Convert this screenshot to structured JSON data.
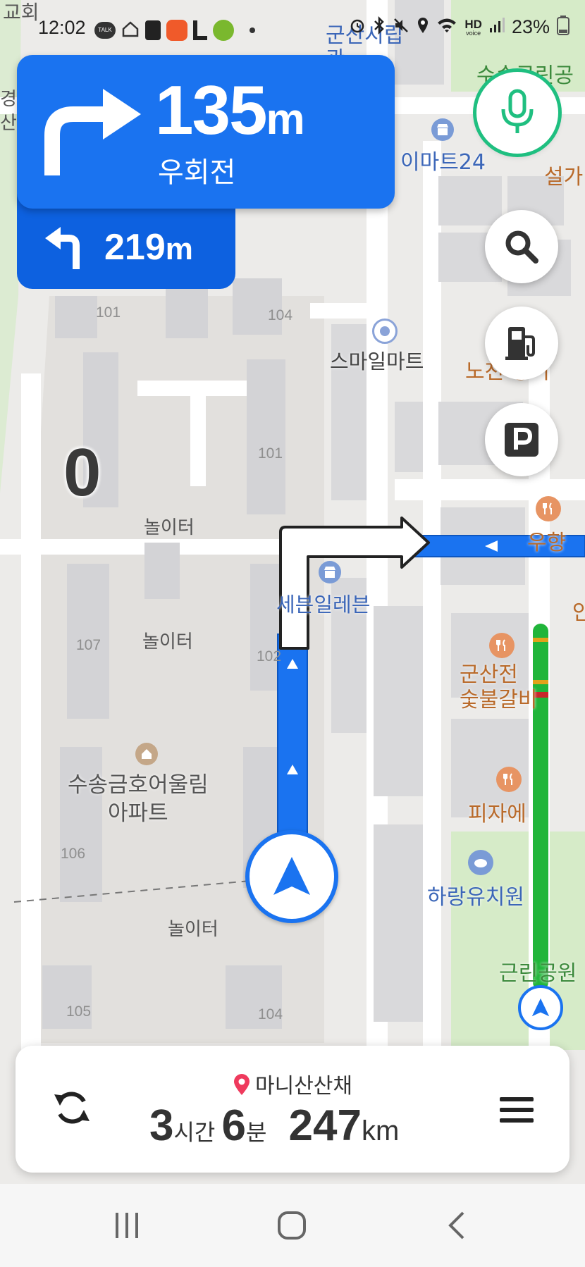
{
  "status_bar": {
    "time": "12:02",
    "talk_badge": "TALK",
    "battery": "23%",
    "hd_label": "HD",
    "voice_label": "voice"
  },
  "guidance": {
    "primary": {
      "distance": "135",
      "unit": "m",
      "direction": "우회전",
      "icon": "turn-right-arrow"
    },
    "secondary": {
      "distance": "219",
      "unit": "m",
      "icon": "turn-left-arrow"
    }
  },
  "speed": "0",
  "map_labels": {
    "poi_emart24": "이마트24",
    "poi_smile": "스마일마트",
    "poi_seven": "세븐일레븐",
    "poi_woohyang": "우향",
    "poi_gunsan": "군산전\n숯불갈비",
    "poi_pizza": "피자에",
    "poi_harang": "하랑유치원",
    "poi_park": "근린공원",
    "apt_name": "수송금호어울림\n아파트",
    "playground_1": "놀이터",
    "playground_2": "놀이터",
    "playground_3": "놀이터",
    "top_library": "군산시립\n관",
    "top_park": "수송근린공",
    "top_seolga": "설가",
    "top_church": "교회",
    "left_edge": "경\n산",
    "nocheon": "노천 장어",
    "right_an": "안",
    "buildings": [
      "101",
      "104",
      "101",
      "107",
      "102",
      "106",
      "105",
      "104"
    ]
  },
  "trip": {
    "destination": "마니산산채",
    "hours": "3",
    "hours_label": "시간",
    "minutes": "6",
    "minutes_label": "분",
    "distance": "247",
    "distance_unit": "km"
  },
  "colors": {
    "route": "#1a73f0",
    "banner": "#1a73f0",
    "banner_secondary": "#0d61e0",
    "mic": "#1fbf80",
    "park_green": "#d6ebc8",
    "traffic_green": "#21b53a"
  }
}
